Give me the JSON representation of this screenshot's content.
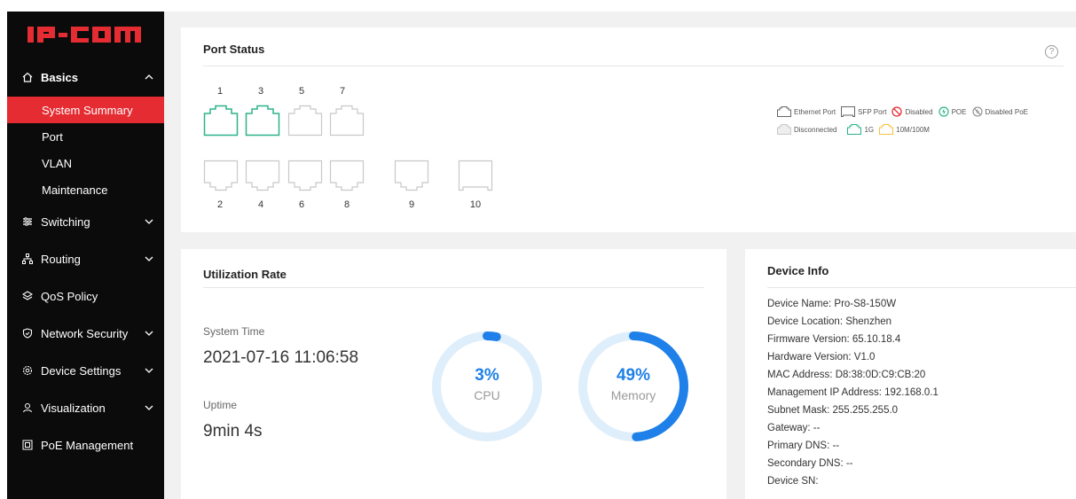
{
  "brand": {
    "logo_text": "IP-COM",
    "accent": "#e42c32"
  },
  "sidebar": {
    "groups": [
      {
        "label": "Basics",
        "icon": "home-icon",
        "expanded": true,
        "items": [
          {
            "label": "System Summary",
            "selected": true
          },
          {
            "label": "Port"
          },
          {
            "label": "VLAN"
          },
          {
            "label": "Maintenance"
          }
        ]
      },
      {
        "label": "Switching",
        "icon": "switching-icon"
      },
      {
        "label": "Routing",
        "icon": "routing-icon"
      },
      {
        "label": "QoS Policy",
        "icon": "qos-icon"
      },
      {
        "label": "Network Security",
        "icon": "shield-icon"
      },
      {
        "label": "Device Settings",
        "icon": "gear-icon"
      },
      {
        "label": "Visualization",
        "icon": "visualization-icon"
      },
      {
        "label": "PoE Management",
        "icon": "poe-icon"
      }
    ]
  },
  "port_status": {
    "title": "Port Status",
    "help": "?",
    "top_ports": [
      "1",
      "3",
      "5",
      "7"
    ],
    "bottom_ports": [
      "2",
      "4",
      "6",
      "8",
      "9",
      "10"
    ],
    "connected_ports": [
      "1",
      "3"
    ],
    "legend": {
      "ethernet": "Ethernet Port",
      "sfp": "SFP Port",
      "disabled": "Disabled",
      "poe": "POE",
      "disabled_poe": "Disabled PoE",
      "disconnected": "Disconnected",
      "g1": "1G",
      "m10_100": "10M/100M"
    },
    "colors": {
      "connected": "#2bb38a",
      "disconnected": "#c8c8c8",
      "slow": "#f5c342",
      "disabled": "#e42c32",
      "poe": "#2bb38a"
    }
  },
  "utilization": {
    "title": "Utilization Rate",
    "system_time_label": "System Time",
    "system_time": "2021-07-16 11:06:58",
    "uptime_label": "Uptime",
    "uptime": "9min 4s",
    "cpu": {
      "percent": 3,
      "text": "3%",
      "label": "CPU"
    },
    "memory": {
      "percent": 49,
      "text": "49%",
      "label": "Memory"
    },
    "colors": {
      "arc": "#1e80e8",
      "track": "#dfeefb"
    }
  },
  "device_info": {
    "title": "Device Info",
    "rows": [
      "Device Name: Pro-S8-150W",
      "Device Location: Shenzhen",
      "Firmware Version: 65.10.18.4",
      "Hardware Version: V1.0",
      "MAC Address: D8:38:0D:C9:CB:20",
      "Management IP Address: 192.168.0.1",
      "Subnet Mask: 255.255.255.0",
      "Gateway: --",
      "Primary DNS: --",
      "Secondary DNS: --",
      "Device SN:"
    ]
  }
}
